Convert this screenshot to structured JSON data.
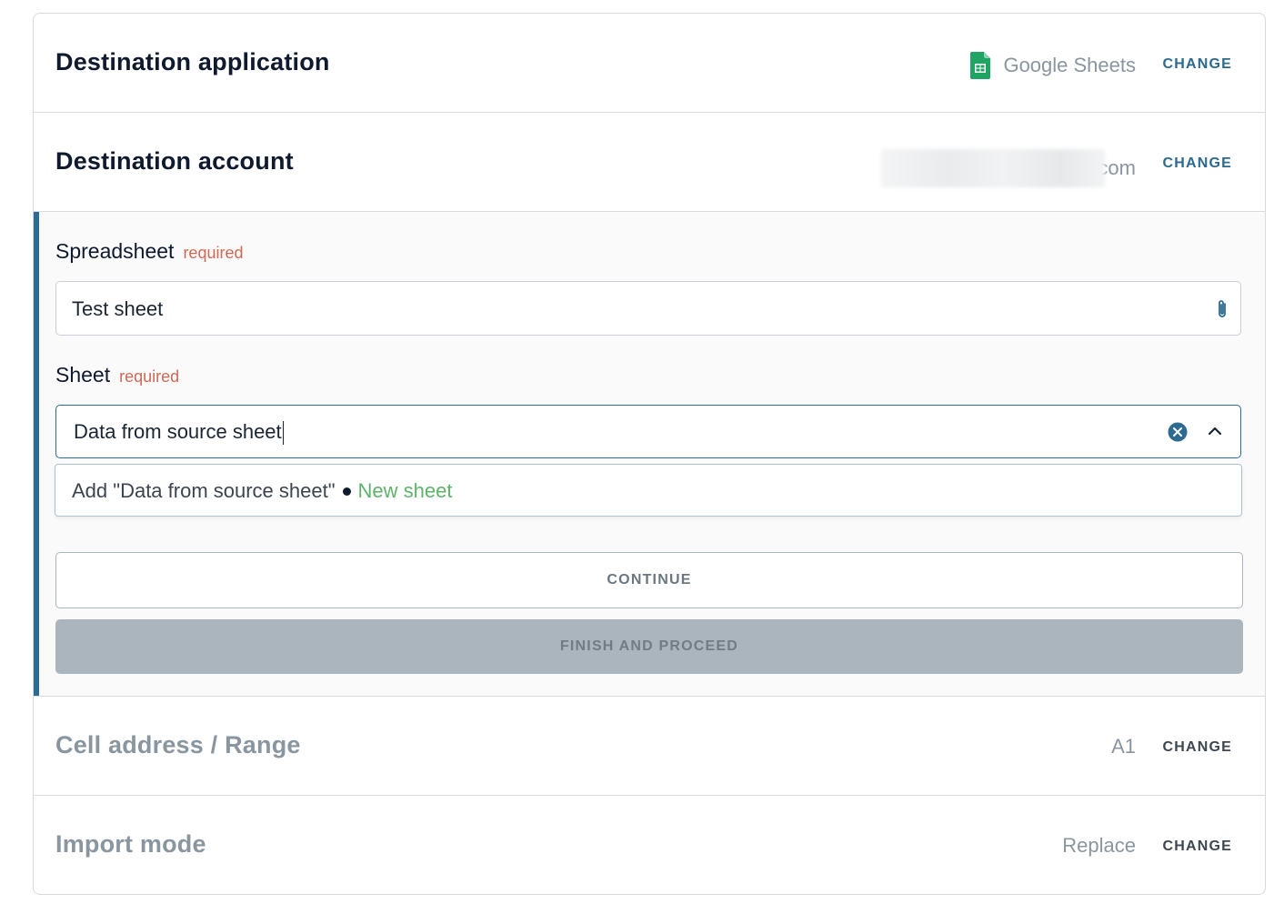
{
  "rows": {
    "destination_app": {
      "title": "Destination application",
      "value": "Google Sheets",
      "icon": "google-sheets-icon",
      "change": "CHANGE"
    },
    "destination_account": {
      "title": "Destination account",
      "value": ".com",
      "change": "CHANGE"
    },
    "cell_address": {
      "title": "Cell address / Range",
      "value": "A1",
      "change": "CHANGE"
    },
    "import_mode": {
      "title": "Import mode",
      "value": "Replace",
      "change": "CHANGE"
    }
  },
  "form": {
    "spreadsheet": {
      "label": "Spreadsheet",
      "required": "required",
      "value": "Test sheet",
      "icon": "paperclip-icon"
    },
    "sheet": {
      "label": "Sheet",
      "required": "required",
      "value": "Data from source sheet",
      "clear_icon": "clear-circle-icon",
      "toggle_icon": "chevron-up-icon"
    },
    "dropdown": {
      "option_text": "Add \"Data from source sheet\"",
      "option_tag": "New sheet"
    },
    "continue_label": "CONTINUE",
    "finish_label": "FINISH AND PROCEED"
  },
  "colors": {
    "accent": "#2e6b90",
    "required": "#cc6a55",
    "new_sheet": "#5fb36a",
    "muted": "#8a969f"
  }
}
